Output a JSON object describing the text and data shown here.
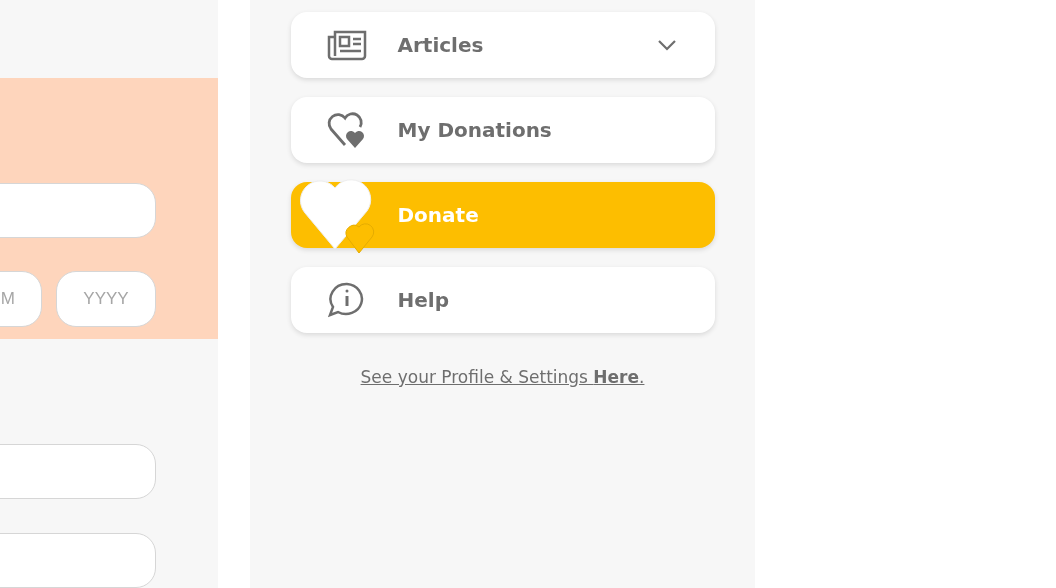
{
  "form": {
    "fields": [
      {
        "kind": "wide"
      },
      {
        "kind": "date",
        "parts": [
          {
            "placeholder": "M"
          },
          {
            "placeholder": "YYYY"
          }
        ]
      },
      {
        "kind": "wide"
      },
      {
        "kind": "wide"
      }
    ]
  },
  "menu": {
    "items": [
      {
        "label": "Articles",
        "kind": "dropdown",
        "expanded": false,
        "selected": false
      },
      {
        "label": "My Donations",
        "kind": "link",
        "selected": false
      },
      {
        "label": "Donate",
        "kind": "link",
        "selected": true
      },
      {
        "label": "Help",
        "kind": "link",
        "selected": false
      }
    ],
    "profile_link": "See your Profile & Settings **Here**."
  }
}
